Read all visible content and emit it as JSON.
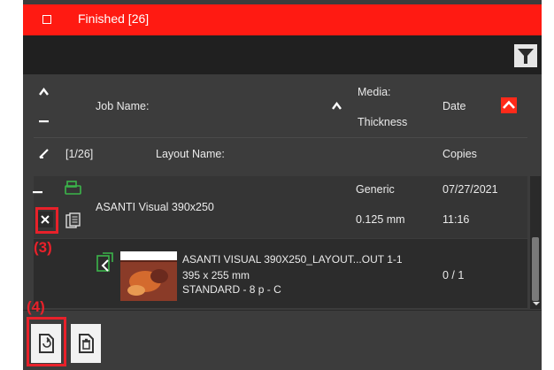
{
  "header": {
    "title": "Finished [26]"
  },
  "columns": {
    "job_name": "Job Name:",
    "media": "Media:",
    "thickness": "Thickness",
    "date": "Date",
    "count": "[1/26]",
    "layout_name": "Layout Name:",
    "copies": "Copies"
  },
  "job": {
    "name": "ASANTI Visual 390x250",
    "media": "Generic",
    "thickness": "0.125 mm",
    "date": "07/27/2021",
    "time": "11:16"
  },
  "layout": {
    "name": "ASANTI VISUAL 390X250_LAYOUT...OUT 1-1",
    "size": "395 x 255 mm",
    "mode": "STANDARD - 8 p - C",
    "copies": "0 / 1"
  },
  "annotations": {
    "three": "(3)",
    "four": "(4)"
  },
  "colors": {
    "accent": "#ff1a12",
    "annotation": "#e8212a",
    "panel": "#3c3c3c",
    "icon_green": "#3bb54a"
  }
}
